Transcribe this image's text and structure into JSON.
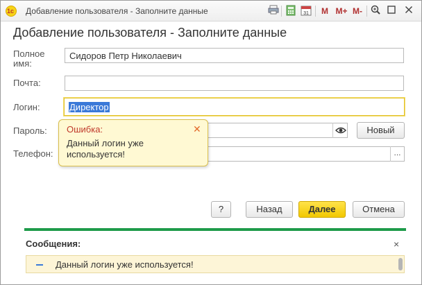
{
  "window": {
    "title": "Добавление пользователя - Заполните данные",
    "toolbar": {
      "m_label": "M",
      "mplus_label": "M+",
      "mminus_label": "M-",
      "calendar_label": "31"
    }
  },
  "form": {
    "title": "Добавление пользователя - Заполните данные",
    "fields": {
      "fullname": {
        "label": "Полное\nимя:",
        "value": "Сидоров Петр Николаевич"
      },
      "email": {
        "label": "Почта:",
        "value": ""
      },
      "login": {
        "label": "Логин:",
        "value": "Директор"
      },
      "password": {
        "label": "Пароль:",
        "value": "",
        "new_button": "Новый"
      },
      "phone": {
        "label": "Телефон:",
        "value": "",
        "dots_button": "..."
      }
    },
    "tooltip": {
      "title": "Ошибка:",
      "text": "Данный логин уже используется!",
      "close": "✕"
    },
    "buttons": {
      "help": "?",
      "back": "Назад",
      "next": "Далее",
      "cancel": "Отмена"
    }
  },
  "messages": {
    "title": "Сообщения:",
    "close": "×",
    "items": [
      {
        "text": "Данный логин уже используется!"
      }
    ]
  },
  "colors": {
    "accent_green": "#1e9b4a",
    "primary_button": "#f2c800",
    "error_text": "#c0392b",
    "selection": "#3a79d8"
  }
}
